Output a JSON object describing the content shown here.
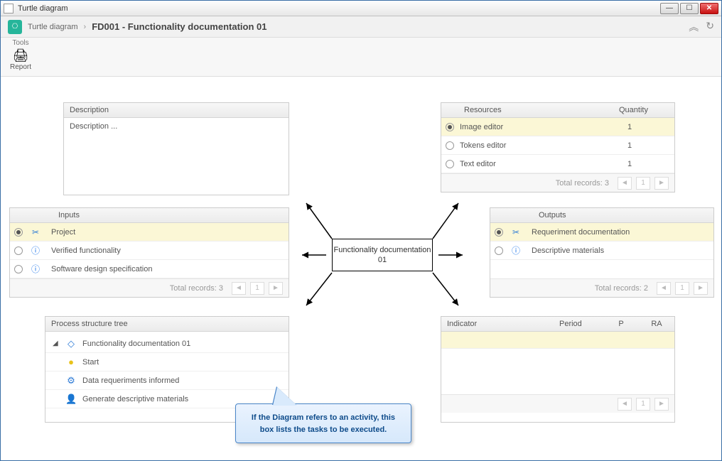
{
  "window": {
    "title": "Turtle diagram"
  },
  "breadcrumb": {
    "root": "Turtle diagram",
    "sep": "›",
    "current": "FD001 - Functionality documentation 01"
  },
  "ribbon": {
    "group": "Tools",
    "report": "Report"
  },
  "description": {
    "header": "Description",
    "body": "Description ..."
  },
  "resources": {
    "header_name": "Resources",
    "header_qty": "Quantity",
    "rows": [
      {
        "name": "Image editor",
        "qty": "1",
        "selected": true
      },
      {
        "name": "Tokens editor",
        "qty": "1",
        "selected": false
      },
      {
        "name": "Text editor",
        "qty": "1",
        "selected": false
      }
    ],
    "total": "Total records: 3",
    "page": "1"
  },
  "inputs": {
    "header": "Inputs",
    "rows": [
      {
        "icon": "✂",
        "name": "Project",
        "selected": true
      },
      {
        "icon": "ⓘ",
        "name": "Verified functionality",
        "selected": false
      },
      {
        "icon": "ⓘ",
        "name": "Software design specification",
        "selected": false
      }
    ],
    "total": "Total records: 3",
    "page": "1"
  },
  "outputs": {
    "header": "Outputs",
    "rows": [
      {
        "icon": "✂",
        "name": "Requeriment documentation",
        "selected": true
      },
      {
        "icon": "ⓘ",
        "name": "Descriptive materials",
        "selected": false
      }
    ],
    "total": "Total records: 2",
    "page": "1"
  },
  "center": {
    "title": "Functionality documentation 01"
  },
  "tree": {
    "title": "Process structure tree",
    "root": "Functionality documentation 01",
    "items": [
      {
        "icon": "●",
        "color": "#e8c21a",
        "label": "Start"
      },
      {
        "icon": "⚙",
        "color": "#2e7bd6",
        "label": "Data requeriments informed"
      },
      {
        "icon": "👤",
        "color": "#2e7bd6",
        "label": "Generate descriptive materials"
      }
    ]
  },
  "indicator": {
    "cols": {
      "c1": "Indicator",
      "c2": "Period",
      "c3": "P",
      "c4": "RA"
    },
    "page": "1"
  },
  "callout": {
    "text": "If the Diagram refers to an activity, this box lists the tasks to be executed."
  }
}
